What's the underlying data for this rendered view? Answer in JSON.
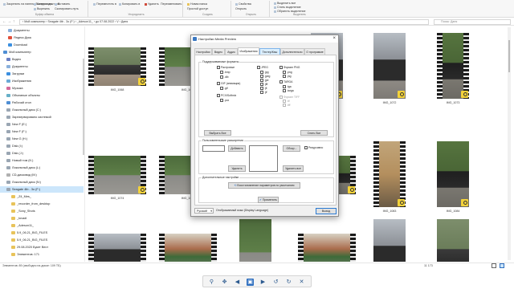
{
  "colors": {
    "accent": "#2f6fbf",
    "selection": "#cce6fb",
    "badge": "#f3d23a",
    "dialog_bg": "#f0f0f0"
  },
  "ribbon": {
    "groups": [
      {
        "label": "Буфер обмена",
        "items": [
          "Закрепить на панели быстрого доступа",
          "Копировать",
          "Вставить",
          "Вырезать",
          "Скопировать путь",
          "Вставить ярлык"
        ]
      },
      {
        "label": "Упорядочить",
        "items": [
          "Переместить в",
          "Копировать в",
          "Удалить",
          "Переименовать"
        ]
      },
      {
        "label": "Создать",
        "items": [
          "Новая папка",
          "Простой доступ"
        ]
      },
      {
        "label": "Открыть",
        "items": [
          "Свойства",
          "Открыть",
          "Изменить",
          "Журнал"
        ]
      },
      {
        "label": "Выделить",
        "items": [
          "Выделить все",
          "Снять выделение",
          "Обратить выделение"
        ]
      }
    ]
  },
  "address": {
    "path": "›  Мой компьютер  ›  Seagate 4tb - 3o (F:)  ›  _Adeson11_  ›  до 07.08.2022  ›  V  ›  Даня",
    "search_placeholder": "Поиск: Даня"
  },
  "sidebar": {
    "items": [
      {
        "label": "Документы",
        "icon": "documents-icon"
      },
      {
        "label": "Яндекс.Диск",
        "icon": "cloud-icon"
      },
      {
        "label": "Download",
        "icon": "download-icon"
      },
      {
        "label": "Мой компьютер",
        "icon": "computer-icon"
      },
      {
        "label": "Видео",
        "icon": "video-icon"
      },
      {
        "label": "Документы",
        "icon": "documents-icon"
      },
      {
        "label": "Загрузки",
        "icon": "download-icon"
      },
      {
        "label": "Изображения",
        "icon": "images-icon"
      },
      {
        "label": "Музыка",
        "icon": "music-icon"
      },
      {
        "label": "Объемные объекты",
        "icon": "cube-icon"
      },
      {
        "label": "Рабочий стол",
        "icon": "desktop-icon"
      },
      {
        "label": "Локальный диск (C:)",
        "icon": "drive-icon"
      },
      {
        "label": "Зарезервировано системой",
        "icon": "drive-icon"
      },
      {
        "label": "New F (E:)",
        "icon": "drive-icon"
      },
      {
        "label": "New F (F:)",
        "icon": "drive-icon"
      },
      {
        "label": "New G (H:)",
        "icon": "drive-icon"
      },
      {
        "label": "Disk (I:)",
        "icon": "drive-icon"
      },
      {
        "label": "Disk (J:)",
        "icon": "drive-icon"
      },
      {
        "label": "Новый том (K:)",
        "icon": "drive-icon"
      },
      {
        "label": "Локальный диск (L:)",
        "icon": "drive-icon"
      },
      {
        "label": "CD-дисковод (M:)",
        "icon": "disc-icon"
      },
      {
        "label": "Локальный диск (N:)",
        "icon": "drive-icon"
      },
      {
        "label": "Seagate 4tb - 3o (F:)",
        "icon": "drive-icon",
        "active": true
      },
      {
        "label": "_Z4_Mes_",
        "icon": "folder-icon"
      },
      {
        "label": "_recorder_from_desktop",
        "icon": "folder-icon"
      },
      {
        "label": "_Sony_Shots",
        "icon": "folder-icon"
      },
      {
        "label": "_tovadi",
        "icon": "folder-icon"
      },
      {
        "label": "_Adeson11_",
        "icon": "folder-icon"
      },
      {
        "label": "5.9_06.21_BIG_FILES",
        "icon": "folder-icon"
      },
      {
        "label": "5.9_06.21_BIG_FILES",
        "icon": "folder-icon"
      },
      {
        "label": "29.08.2020 Букет Вест",
        "icon": "folder-icon"
      },
      {
        "label": "Элементов: 171",
        "icon": "folder-icon"
      }
    ]
  },
  "thumbnails": [
    {
      "caption": "IMG_1068",
      "type": "video",
      "scene": "woman-park"
    },
    {
      "caption": "IMG_1069",
      "type": "video",
      "scene": "trees-path"
    },
    {
      "caption": "IMG_1070",
      "type": "video",
      "scene": "trees-path"
    },
    {
      "caption": "IMG_1071",
      "type": "photo",
      "scene": "woman-street"
    },
    {
      "caption": "IMG_1072",
      "type": "photo",
      "scene": "woman-street"
    },
    {
      "caption": "IMG_1073",
      "type": "video",
      "scene": "woman-trees"
    },
    {
      "caption": "IMG_1074",
      "type": "video",
      "scene": "trees-path"
    },
    {
      "caption": "IMG_1075",
      "type": "video",
      "scene": "trees-path"
    },
    {
      "caption": "IMG_1076",
      "type": "video",
      "scene": "woman-street"
    },
    {
      "caption": "IMG_1082",
      "type": "video",
      "scene": "woman-trees"
    },
    {
      "caption": "IMG_1083",
      "type": "video",
      "scene": "hallway"
    },
    {
      "caption": "IMG_1084",
      "type": "photo",
      "scene": "woman-trees"
    },
    {
      "caption": "IMG_1085",
      "type": "video",
      "scene": "woman-street"
    },
    {
      "caption": "IMG_1086",
      "type": "video",
      "scene": "playground"
    },
    {
      "caption": "IMG_1087",
      "type": "photo",
      "scene": "trees-path"
    },
    {
      "caption": "IMG_1088",
      "type": "video",
      "scene": "playground"
    },
    {
      "caption": "IMG_1089",
      "type": "photo",
      "scene": "woman-street"
    },
    {
      "caption": "IMG_1090",
      "type": "photo",
      "scene": "woman-park"
    }
  ],
  "status": {
    "left": "Элементов: 89 (свободно на диске: 109 ТБ)",
    "mid": "11 173",
    "right": ""
  },
  "dialog": {
    "title": "Настройки Media Preview",
    "tabs": [
      "Настройки",
      "Видео",
      "Аудио",
      "Изображения",
      "Тестер/Кэш",
      "Дополнительно",
      "О программе"
    ],
    "selected_tab": 3,
    "hover_tab": 4,
    "formats_legend": "Поддерживаемые форматы",
    "formats": [
      {
        "label": "Растровые",
        "checked": false,
        "disabled": false
      },
      {
        "label": ".bmp",
        "checked": false,
        "disabled": false
      },
      {
        "label": ".dib",
        "checked": false,
        "disabled": false
      },
      {
        "label": "GIF (анимация)",
        "checked": false,
        "disabled": false
      },
      {
        "label": ".gif",
        "checked": false,
        "disabled": false
      },
      {
        "label": "PCX/Softmix",
        "checked": false,
        "disabled": false
      },
      {
        "label": ".pcx",
        "checked": false,
        "disabled": false
      },
      {
        "label": "JPEG",
        "checked": false,
        "disabled": false
      },
      {
        "label": ".jpg",
        "checked": false,
        "disabled": false
      },
      {
        "label": ".jpeg",
        "checked": false,
        "disabled": false
      },
      {
        "label": ".jpe",
        "checked": false,
        "disabled": false
      },
      {
        "label": ".jfif",
        "checked": false,
        "disabled": false
      },
      {
        "label": ".jfi",
        "checked": false,
        "disabled": false
      },
      {
        "label": ".jif",
        "checked": false,
        "disabled": false
      },
      {
        "label": "Формат PNG",
        "checked": false,
        "disabled": false
      },
      {
        "label": ".png",
        "checked": false,
        "disabled": false
      },
      {
        "label": ".jng",
        "checked": false,
        "disabled": false
      },
      {
        "label": "TARGA",
        "checked": false,
        "disabled": false
      },
      {
        "label": ".tga",
        "checked": false,
        "disabled": false
      },
      {
        "label": ".targa",
        "checked": false,
        "disabled": false
      },
      {
        "label": "Формат TIFF",
        "checked": false,
        "disabled": true
      },
      {
        "label": ".tif",
        "checked": false,
        "disabled": true
      },
      {
        "label": ".tiff",
        "checked": false,
        "disabled": true
      }
    ],
    "select_all": "Выбрать Все",
    "clear_all": "Снять Все",
    "custom_legend": "Пользовательские расширения",
    "add_btn": "Добавить",
    "remove_btn": "Удалить",
    "browse_btn": "Обзор...",
    "remove_all_btn": "Удалить все",
    "recursive_label": "Рекурсивно",
    "extra_legend": "Дополнительные настройки",
    "reset_btn": "Восстановление параметров по умолчанию",
    "apply_btn": "Применить",
    "language": "Русский",
    "display_lang_label": "Отображаемый язык (Display Language)",
    "exit_btn": "Выход"
  },
  "viewer": {
    "icons": [
      "zoom-icon",
      "pan-icon",
      "prev-icon",
      "fit-icon",
      "next-icon",
      "rotate-left-icon",
      "rotate-right-icon",
      "close-icon"
    ]
  }
}
